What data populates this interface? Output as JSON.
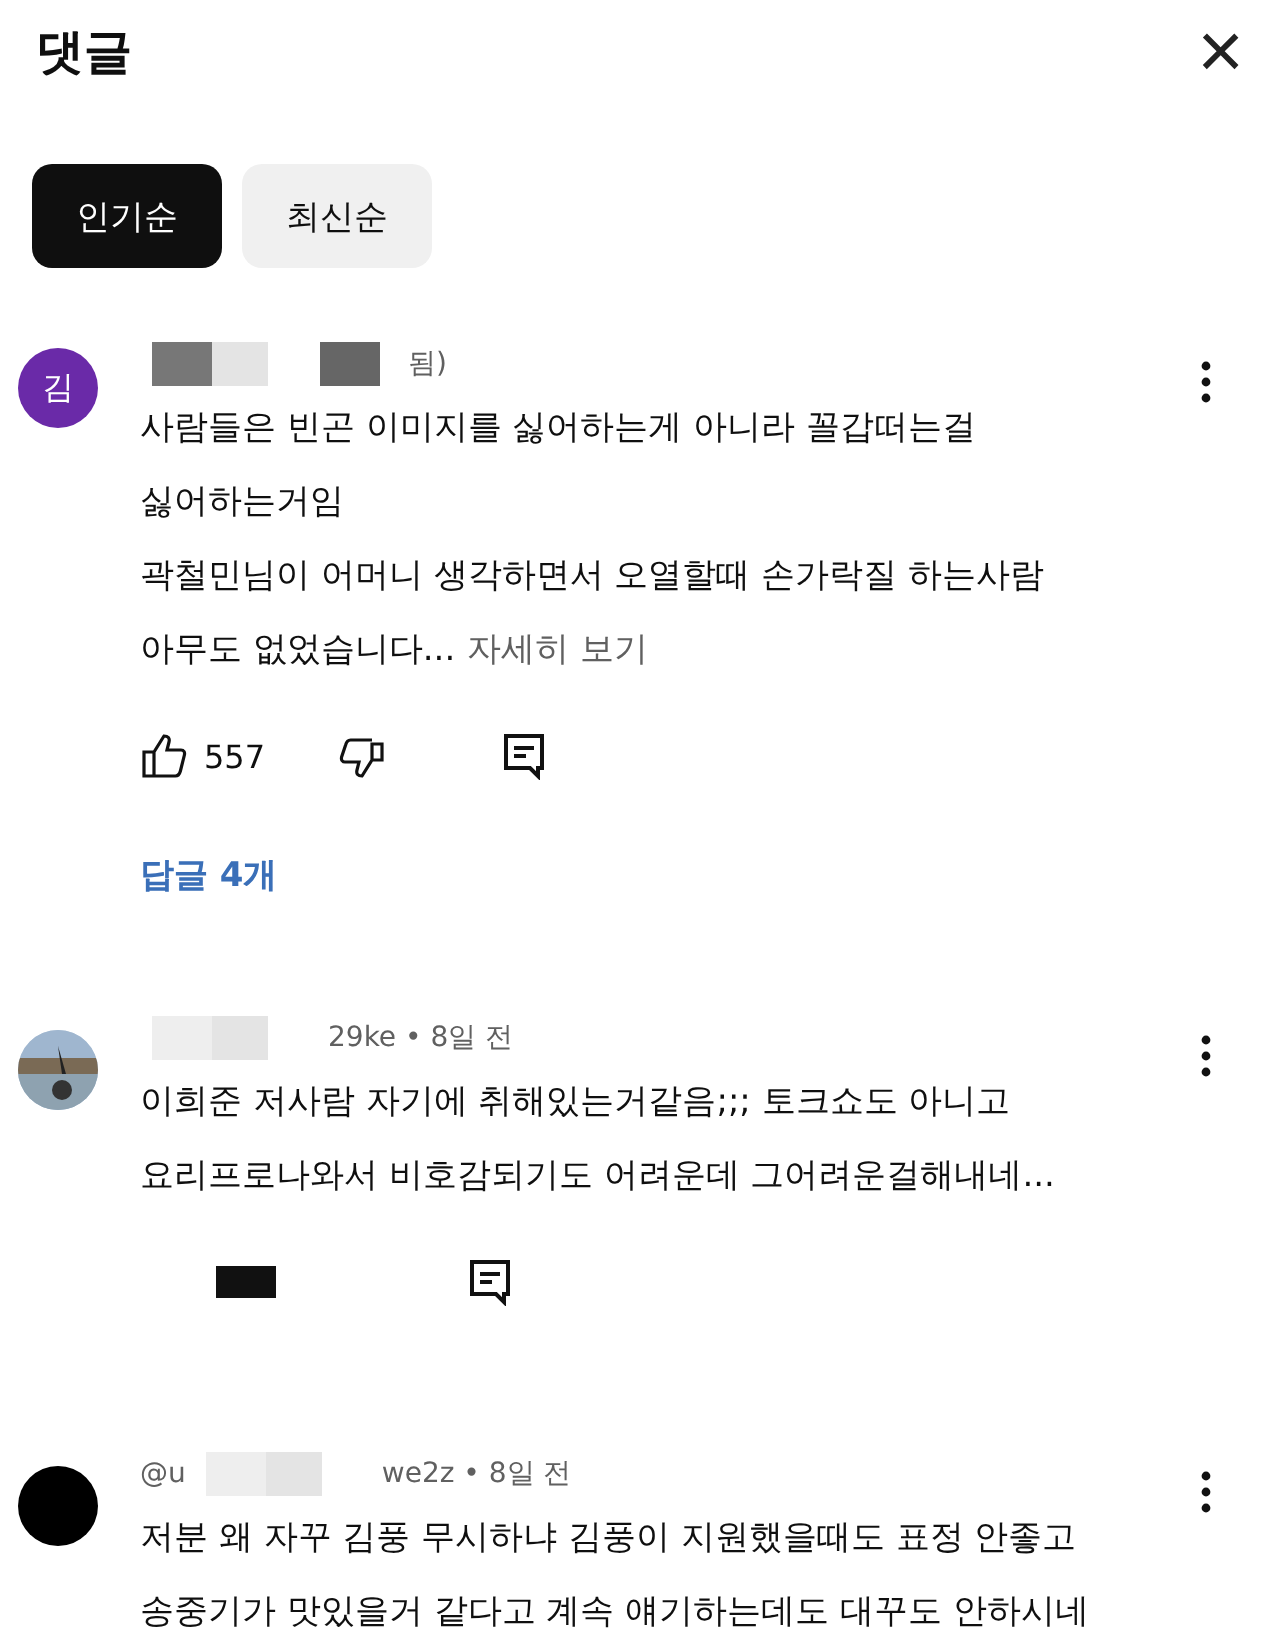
{
  "header": {
    "title": "댓글",
    "close": "×"
  },
  "tabs": [
    {
      "label": "인기순",
      "selected": true
    },
    {
      "label": "최신순",
      "selected": false
    }
  ],
  "comments": [
    {
      "avatar": {
        "kind": "letter",
        "letter": "김",
        "color": "#6a2aa8"
      },
      "meta": "됨)",
      "redacted": true,
      "lines": [
        "사람들은 빈곤 이미지를 싫어하는게 아니라 꼴갑떠는걸",
        "싫어하는거임",
        "곽철민님이 어머니 생각하면서 오열할때 손가락질 하는사람",
        "아무도 없었습니다..."
      ],
      "more": "자세히 보기",
      "likes": "557",
      "actions_hidden": false,
      "replies": "답글 4개"
    },
    {
      "avatar": {
        "kind": "picture"
      },
      "meta": "29ke • 8일 전",
      "redacted": true,
      "lines": [
        "이희준 저사람 자기에 취해있는거같음;;;  토크쇼도 아니고",
        "요리프로나와서 비호감되기도 어려운데 그어려운걸해내네..."
      ],
      "actions_hidden": true
    },
    {
      "avatar": {
        "kind": "plain"
      },
      "meta": "we2z • 8일 전",
      "prefix": "@u",
      "redacted": true,
      "lines": [
        "저분 왜 자꾸 김풍 무시하냐 김풍이 지원했을때도 표정 안좋고",
        "송중기가 맛있을거 같다고 계속 얘기하는데도 대꾸도 안하시네"
      ]
    }
  ]
}
